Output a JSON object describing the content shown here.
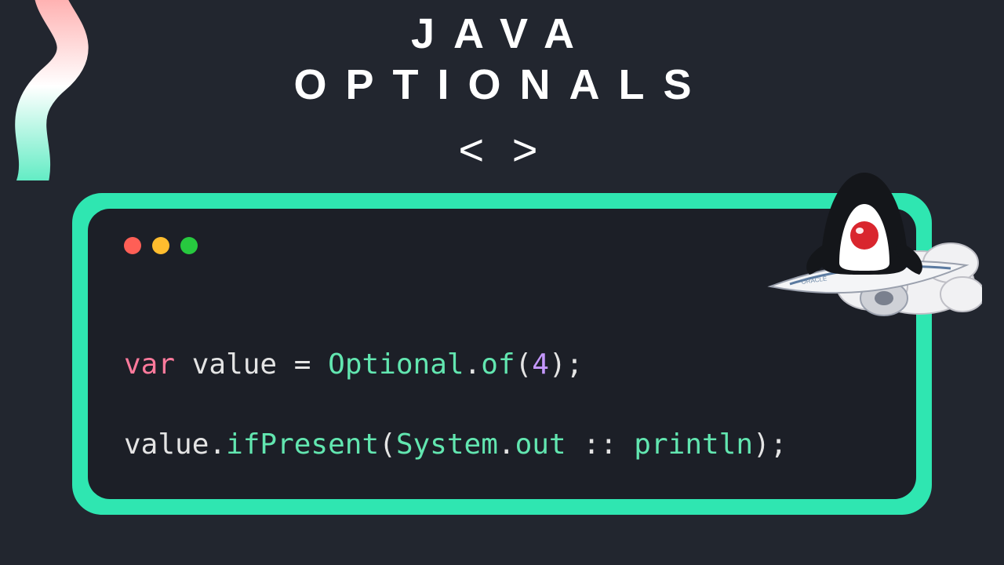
{
  "title": {
    "line1": "JAVA",
    "line2": "OPTIONALS"
  },
  "angles": "<  >",
  "code": {
    "line1": {
      "kw": "var",
      "sp1": " ",
      "id1": "value",
      "sp2": " ",
      "eq": "=",
      "sp3": " ",
      "cls": "Optional",
      "dot": ".",
      "mth": "of",
      "lp": "(",
      "num": "4",
      "rp": ")",
      "semi": ";"
    },
    "line2": {
      "id1": "value",
      "dot1": ".",
      "mth1": "ifPresent",
      "lp": "(",
      "cls": "System",
      "dot2": ".",
      "mth2": "out",
      "colon": " :: ",
      "mth3": "println",
      "rp": ")",
      "semi": ";"
    }
  },
  "colors": {
    "accent": "#2fe6b1",
    "bg": "#22262f",
    "card": "#1c1f27"
  }
}
